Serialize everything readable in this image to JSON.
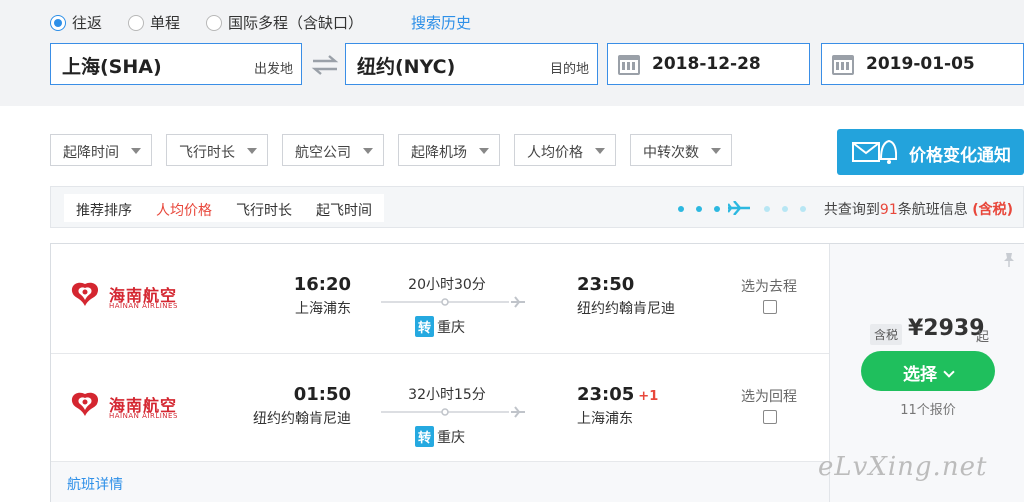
{
  "trip_types": [
    {
      "label": "往返",
      "selected": true
    },
    {
      "label": "单程",
      "selected": false
    },
    {
      "label": "国际多程（含缺口）",
      "selected": false
    }
  ],
  "search_history_label": "搜索历史",
  "origin": {
    "city": "上海(SHA)",
    "hint": "出发地"
  },
  "destination": {
    "city": "纽约(NYC)",
    "hint": "目的地"
  },
  "depart_date": "2018-12-28",
  "return_date": "2019-01-05",
  "filters": [
    "起降时间",
    "飞行时长",
    "航空公司",
    "起降机场",
    "人均价格",
    "中转次数"
  ],
  "notify_label": "价格变化通知",
  "sort_tabs": [
    {
      "label": "推荐排序",
      "active": false
    },
    {
      "label": "人均价格",
      "active": true
    },
    {
      "label": "飞行时长",
      "active": false
    },
    {
      "label": "起飞时间",
      "active": false
    }
  ],
  "result": {
    "prefix": "共查询到",
    "count": "91",
    "suffix": "条航班信息",
    "tax": "(含税)"
  },
  "flight": {
    "segments": [
      {
        "airline_cn": "海南航空",
        "airline_en": "HAINAN AIRLINES",
        "dep_time": "16:20",
        "dep_airport": "上海浦东",
        "duration": "20小时30分",
        "transfer_tag": "转",
        "transfer_city": "重庆",
        "arr_time": "23:50",
        "arr_plus": "",
        "arr_airport": "纽约约翰肯尼迪",
        "pick_label": "选为去程"
      },
      {
        "airline_cn": "海南航空",
        "airline_en": "HAINAN AIRLINES",
        "dep_time": "01:50",
        "dep_airport": "纽约约翰肯尼迪",
        "duration": "32小时15分",
        "transfer_tag": "转",
        "transfer_city": "重庆",
        "arr_time": "23:05",
        "arr_plus": "+1",
        "arr_airport": "上海浦东",
        "pick_label": "选为回程"
      }
    ],
    "tax_badge": "含税",
    "price": "¥2939",
    "price_suffix": "起",
    "select_label": "选择",
    "quote_count": "11个报价",
    "detail_link": "航班详情"
  },
  "watermark": "eLvXing.net",
  "colors": {
    "accent_blue": "#2d8fe8",
    "notify_blue": "#23a3dc",
    "select_green": "#1fbf5d",
    "price_red": "#e8473b",
    "airline_red": "#d42630"
  }
}
